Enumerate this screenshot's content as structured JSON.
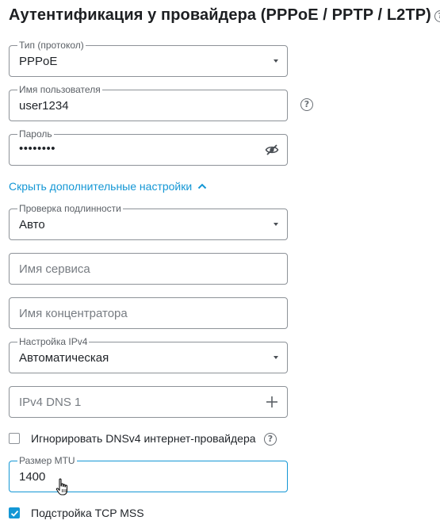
{
  "title": "Аутентификация у провайдера (PPPoE / PPTP / L2TP)",
  "help_glyph": "?",
  "fields": {
    "protocol": {
      "label": "Тип (протокол)",
      "value": "PPPoE"
    },
    "username": {
      "label": "Имя пользователя",
      "value": "user1234"
    },
    "password": {
      "label": "Пароль",
      "value": "••••••••"
    },
    "auth_check": {
      "label": "Проверка подлинности",
      "value": "Авто"
    },
    "service_name": {
      "placeholder": "Имя сервиса"
    },
    "concentrator_name": {
      "placeholder": "Имя концентратора"
    },
    "ipv4_setting": {
      "label": "Настройка IPv4",
      "value": "Автоматическая"
    },
    "ipv4_dns1": {
      "placeholder": "IPv4 DNS 1"
    },
    "mtu": {
      "label": "Размер MTU",
      "value": "1400"
    }
  },
  "toggle_advanced_link": "Скрыть дополнительные настройки",
  "checkboxes": {
    "ignore_dns": {
      "label": "Игнорировать DNSv4 интернет-провайдера",
      "checked": false
    },
    "tcp_mss": {
      "label": "Подстройка TCP MSS",
      "checked": true
    }
  },
  "colors": {
    "accent": "#1497d5",
    "border": "#8d9298",
    "text": "#1f2328"
  },
  "icons": [
    "help-icon",
    "dropdown-caret-icon",
    "eye-slash-icon",
    "chevron-up-icon",
    "plus-icon",
    "checkmark-icon",
    "hand-cursor-icon"
  ]
}
